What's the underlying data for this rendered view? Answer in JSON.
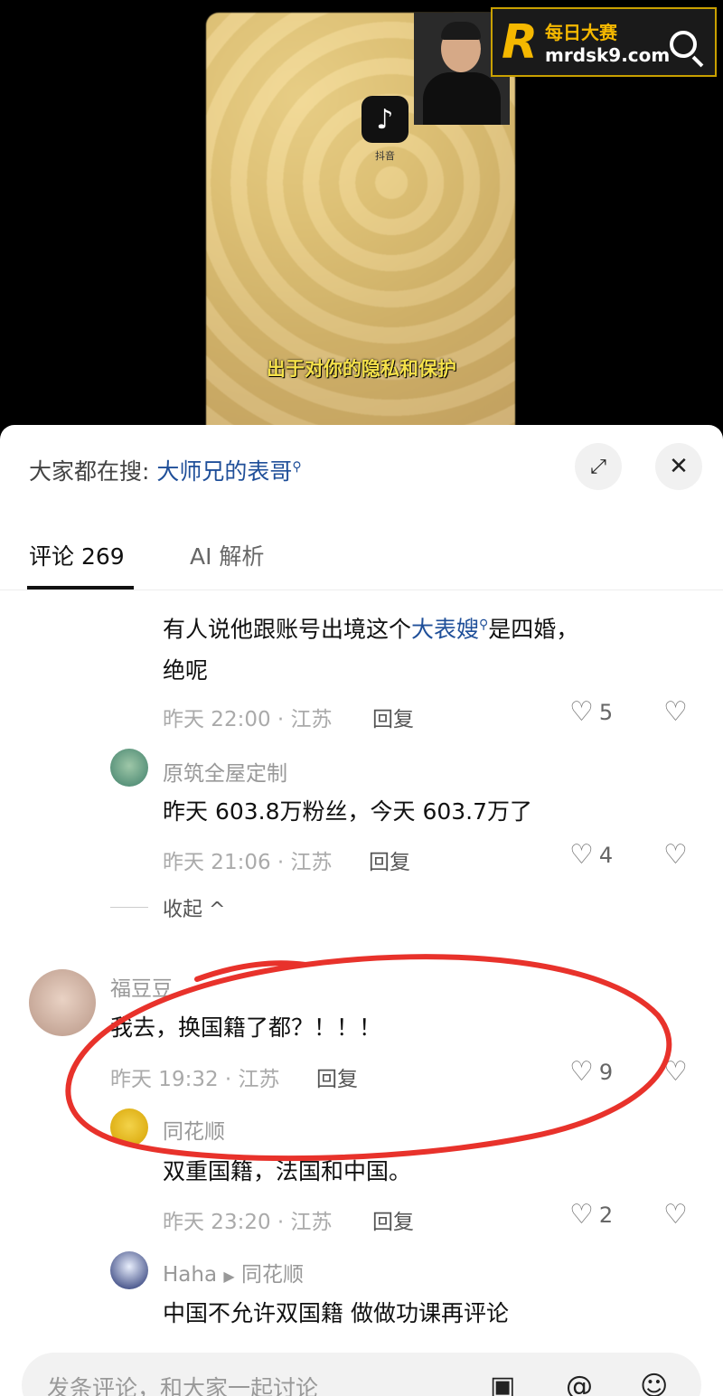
{
  "video": {
    "app_icon_label": "抖音",
    "subtitle": "出于对你的隐私和保护",
    "watermark_line1": "每日大赛",
    "watermark_line2": "mrdsk9.com",
    "watermark_letter": "R"
  },
  "sheet": {
    "search_prefix": "大家都在搜:",
    "search_keyword": "大师兄的表哥",
    "tabs": [
      {
        "label": "评论 269",
        "active": true
      },
      {
        "label": "AI 解析",
        "active": false
      }
    ],
    "collapse_label": "收起",
    "comment_input_placeholder": "发条评论，和大家一起讨论",
    "accent": "#1f4f99"
  },
  "comments": [
    {
      "text_before": "有人说他跟账号出境这个",
      "keyword": "大表嫂",
      "text_after": "是四婚，",
      "text_line2": "绝呢",
      "meta": "昨天 22:00 · 江苏",
      "reply": "回复",
      "likes": "5"
    },
    {
      "name": "原筑全屋定制",
      "text": "昨天 603.8万粉丝，今天 603.7万了",
      "meta": "昨天 21:06 · 江苏",
      "reply": "回复",
      "likes": "4"
    },
    {
      "name": "福豆豆",
      "text": "我去，换国籍了都？！！！",
      "meta": "昨天 19:32 · 江苏",
      "reply": "回复",
      "likes": "9"
    },
    {
      "name": "同花顺",
      "text": "双重国籍，法国和中国。",
      "meta": "昨天 23:20 · 江苏",
      "reply": "回复",
      "likes": "2"
    },
    {
      "name": "Haha",
      "reply_to": "同花顺",
      "text": "中国不允许双国籍 做做功课再评论"
    }
  ]
}
